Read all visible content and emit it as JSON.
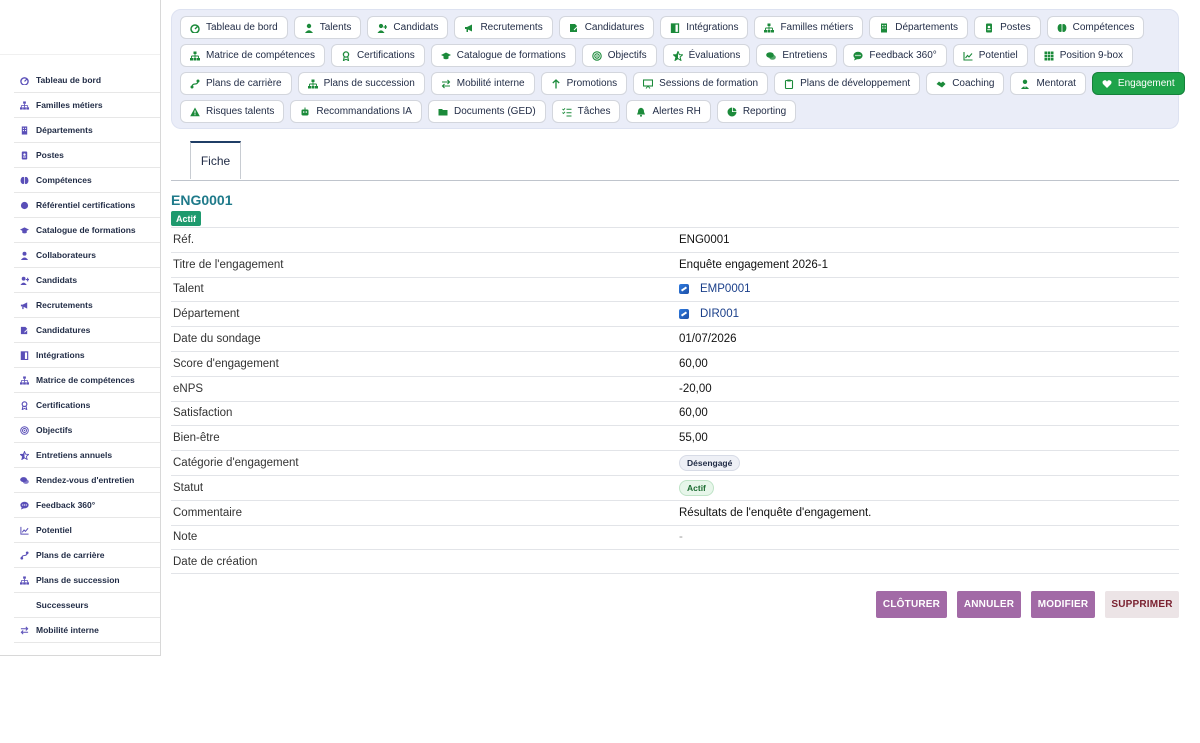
{
  "sidebar": {
    "items": [
      {
        "label": "Tableau de bord",
        "icon": "dashboard-icon"
      },
      {
        "label": "Familles métiers",
        "icon": "sitemap-icon"
      },
      {
        "label": "Départements",
        "icon": "building-icon"
      },
      {
        "label": "Postes",
        "icon": "id-badge-icon"
      },
      {
        "label": "Compétences",
        "icon": "brain-icon"
      },
      {
        "label": "Référentiel certifications",
        "icon": "certificate-icon"
      },
      {
        "label": "Catalogue de formations",
        "icon": "graduation-cap-icon"
      },
      {
        "label": "Collaborateurs",
        "icon": "user-icon"
      },
      {
        "label": "Candidats",
        "icon": "user-plus-icon"
      },
      {
        "label": "Recrutements",
        "icon": "megaphone-icon"
      },
      {
        "label": "Candidatures",
        "icon": "file-signature-icon"
      },
      {
        "label": "Intégrations",
        "icon": "door-icon"
      },
      {
        "label": "Matrice de compétences",
        "icon": "sitemap-icon"
      },
      {
        "label": "Certifications",
        "icon": "award-icon"
      },
      {
        "label": "Objectifs",
        "icon": "target-icon"
      },
      {
        "label": "Entretiens annuels",
        "icon": "star-half-icon"
      },
      {
        "label": "Rendez-vous d'entretien",
        "icon": "comments-icon"
      },
      {
        "label": "Feedback 360°",
        "icon": "comment-dots-icon"
      },
      {
        "label": "Potentiel",
        "icon": "chart-line-icon"
      },
      {
        "label": "Plans de carrière",
        "icon": "route-icon"
      },
      {
        "label": "Plans de succession",
        "icon": "sitemap-icon"
      },
      {
        "label": "Successeurs",
        "icon": "users-icon"
      },
      {
        "label": "Mobilité interne",
        "icon": "exchange-icon"
      }
    ]
  },
  "nav": {
    "rows": [
      [
        {
          "label": "Tableau de bord",
          "icon": "dashboard-icon"
        },
        {
          "label": "Talents",
          "icon": "user-icon"
        },
        {
          "label": "Candidats",
          "icon": "user-plus-icon"
        },
        {
          "label": "Recrutements",
          "icon": "megaphone-icon"
        },
        {
          "label": "Candidatures",
          "icon": "file-signature-icon"
        },
        {
          "label": "Intégrations",
          "icon": "door-icon"
        },
        {
          "label": "Familles métiers",
          "icon": "sitemap-icon"
        },
        {
          "label": "Départements",
          "icon": "building-icon"
        },
        {
          "label": "Postes",
          "icon": "id-badge-icon"
        },
        {
          "label": "Compétences",
          "icon": "brain-icon"
        }
      ],
      [
        {
          "label": "Matrice de compétences",
          "icon": "sitemap-icon"
        },
        {
          "label": "Certifications",
          "icon": "award-icon"
        },
        {
          "label": "Catalogue de formations",
          "icon": "graduation-cap-icon"
        },
        {
          "label": "Objectifs",
          "icon": "target-icon"
        },
        {
          "label": "Évaluations",
          "icon": "star-half-icon"
        },
        {
          "label": "Entretiens",
          "icon": "comments-icon"
        },
        {
          "label": "Feedback 360°",
          "icon": "comment-dots-icon"
        },
        {
          "label": "Potentiel",
          "icon": "chart-line-icon"
        },
        {
          "label": "Position 9-box",
          "icon": "grid-icon"
        }
      ],
      [
        {
          "label": "Plans de carrière",
          "icon": "route-icon"
        },
        {
          "label": "Plans de succession",
          "icon": "sitemap-icon"
        },
        {
          "label": "Mobilité interne",
          "icon": "exchange-icon"
        },
        {
          "label": "Promotions",
          "icon": "arrow-up-icon"
        },
        {
          "label": "Sessions de formation",
          "icon": "chalkboard-icon"
        },
        {
          "label": "Plans de développement",
          "icon": "clipboard-icon"
        },
        {
          "label": "Coaching",
          "icon": "handshake-icon"
        },
        {
          "label": "Mentorat",
          "icon": "user-tie-icon"
        },
        {
          "label": "Engagement",
          "icon": "heart-icon",
          "active": true
        }
      ],
      [
        {
          "label": "Risques talents",
          "icon": "warning-icon"
        },
        {
          "label": "Recommandations IA",
          "icon": "robot-icon"
        },
        {
          "label": "Documents (GED)",
          "icon": "folder-icon"
        },
        {
          "label": "Tâches",
          "icon": "tasks-icon"
        },
        {
          "label": "Alertes RH",
          "icon": "bell-icon"
        },
        {
          "label": "Reporting",
          "icon": "chart-pie-icon"
        }
      ]
    ]
  },
  "tabs": [
    {
      "label": "Fiche"
    }
  ],
  "record": {
    "title": "ENG0001",
    "badge": "Actif",
    "fields": [
      {
        "label": "Réf.",
        "value": "ENG0001"
      },
      {
        "label": "Titre de l'engagement",
        "value": "Enquête engagement 2026-1"
      },
      {
        "label": "Talent",
        "value": "EMP0001",
        "kind": "link"
      },
      {
        "label": "Département",
        "value": "DIR001",
        "kind": "link"
      },
      {
        "label": "Date du sondage",
        "value": "01/07/2026"
      },
      {
        "label": "Score d'engagement",
        "value": "60,00"
      },
      {
        "label": "eNPS",
        "value": "-20,00"
      },
      {
        "label": "Satisfaction",
        "value": "60,00"
      },
      {
        "label": "Bien-être",
        "value": "55,00"
      },
      {
        "label": "Catégorie d'engagement",
        "value": "Désengagé",
        "kind": "pill-neutral"
      },
      {
        "label": "Statut",
        "value": "Actif",
        "kind": "pill-green"
      },
      {
        "label": "Commentaire",
        "value": "Résultats de l'enquête d'engagement."
      },
      {
        "label": "Note",
        "value": "-",
        "kind": "muted"
      },
      {
        "label": "Date de création",
        "value": ""
      }
    ]
  },
  "actions": {
    "close": "CLÔTURER",
    "cancel": "ANNULER",
    "edit": "MODIFIER",
    "delete": "SUPPRIMER"
  },
  "colors": {
    "accent": "#1ea34a",
    "title": "#1f7a8a",
    "action": "#a26aa6",
    "danger_bg": "#ece4e6"
  }
}
